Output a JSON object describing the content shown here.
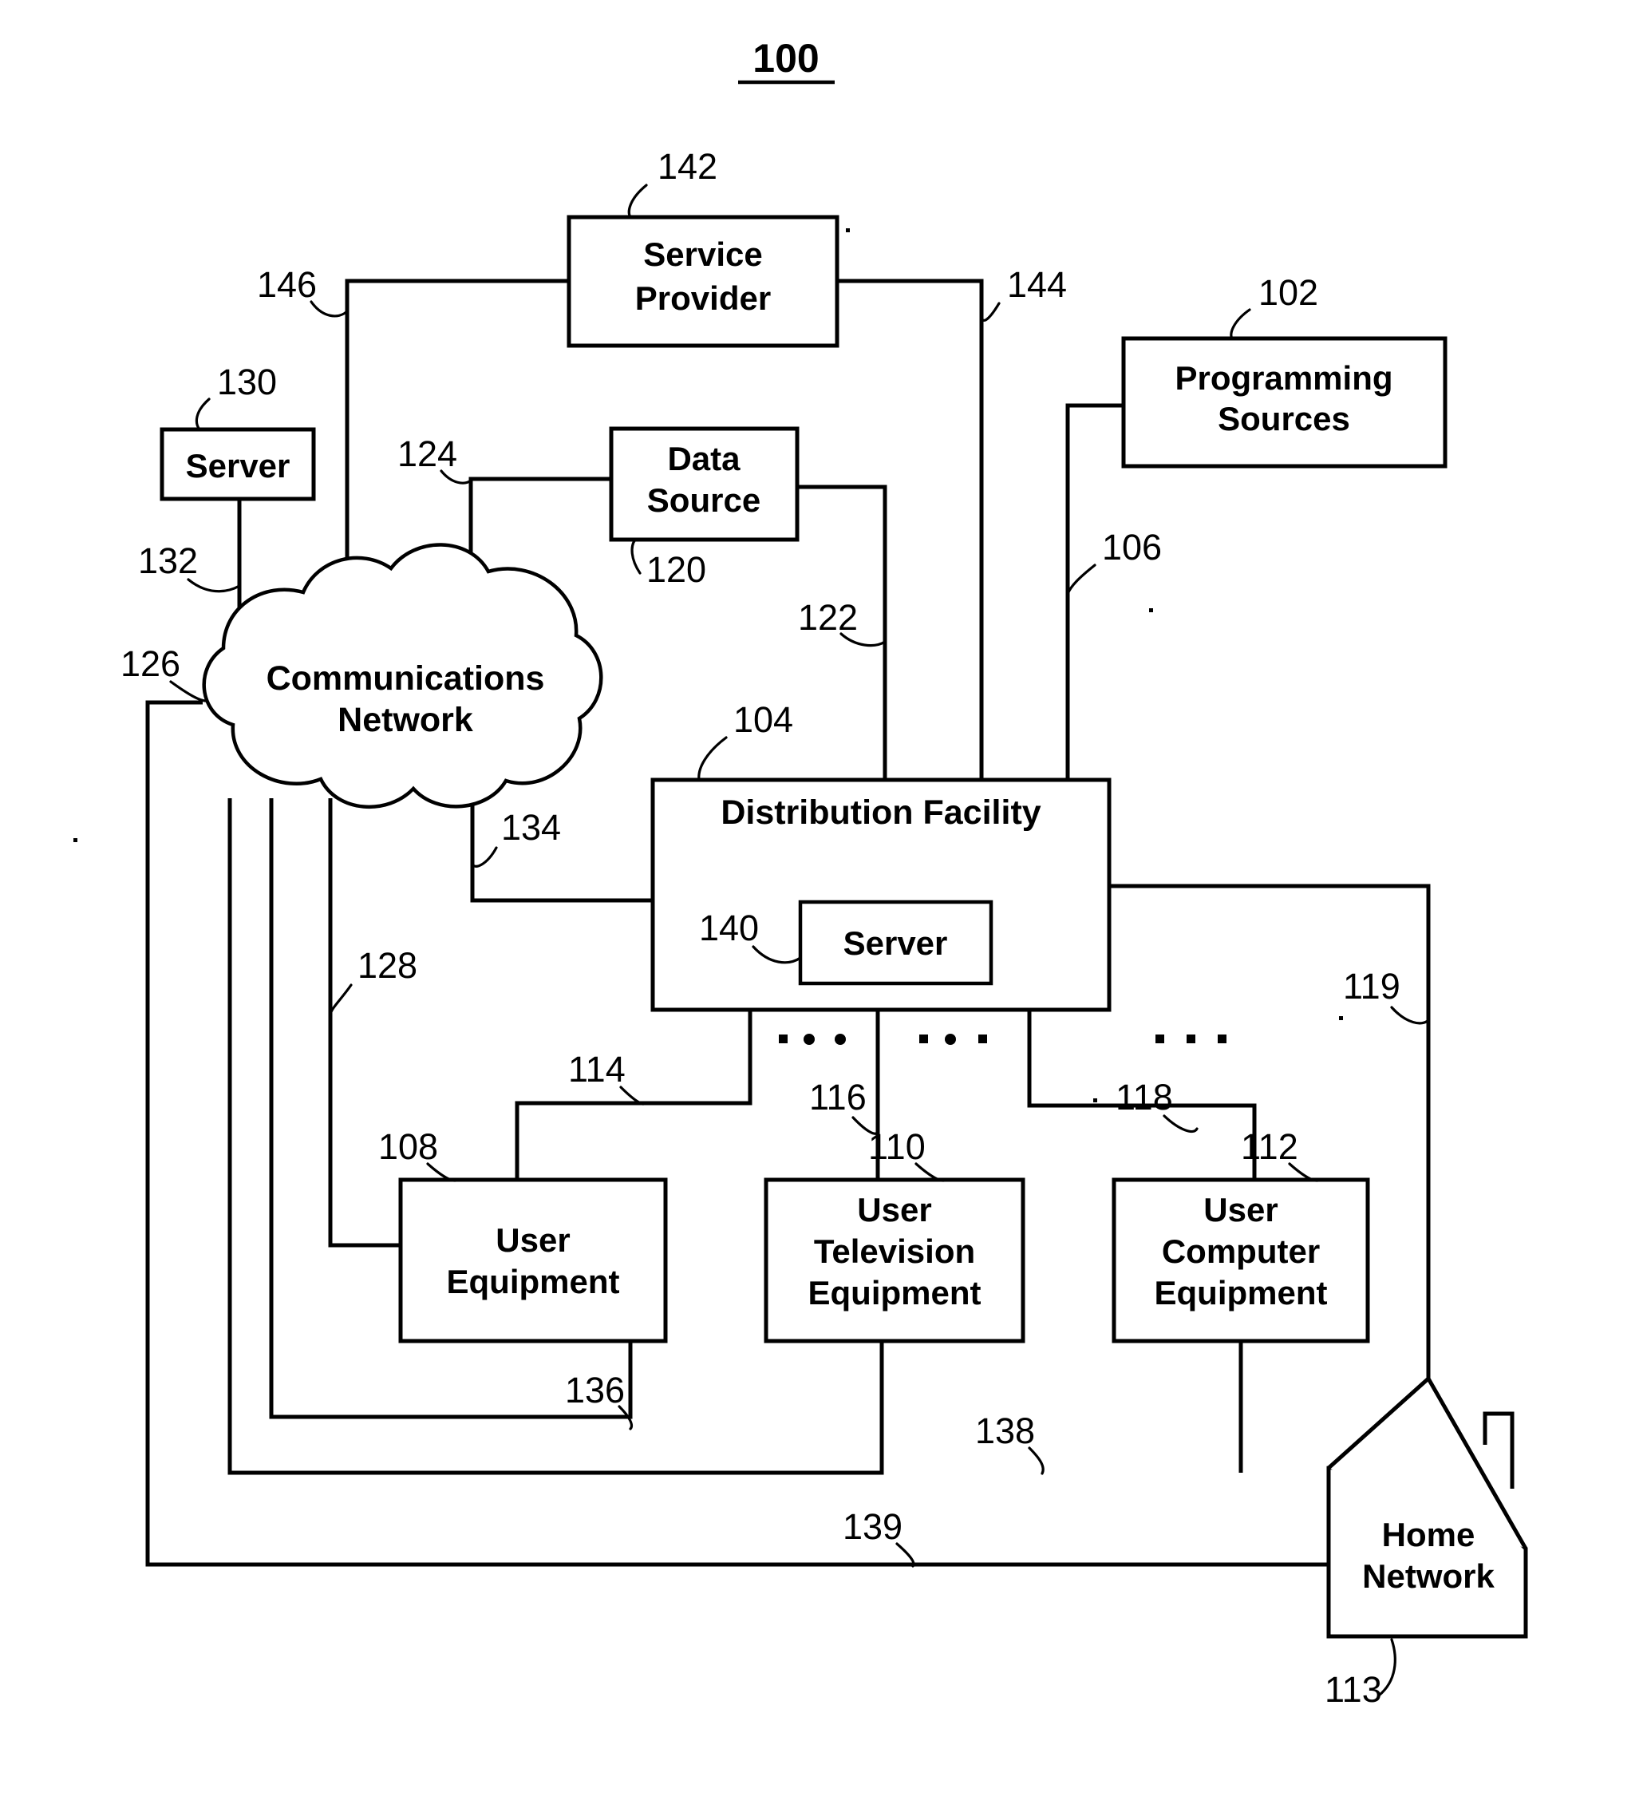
{
  "figure": {
    "title": "100",
    "title_underline": true
  },
  "nodes": {
    "service_provider": {
      "label_line1": "Service",
      "label_line2": "Provider",
      "ref": "142"
    },
    "programming_sources": {
      "label_line1": "Programming",
      "label_line2": "Sources",
      "ref": "102"
    },
    "server_left": {
      "label": "Server",
      "ref": "130"
    },
    "data_source": {
      "label_line1": "Data",
      "label_line2": "Source",
      "ref": "120"
    },
    "communications_network": {
      "label_line1": "Communications",
      "label_line2": "Network",
      "ref": "126"
    },
    "distribution_facility": {
      "label": "Distribution Facility",
      "ref": "104"
    },
    "server_df": {
      "label": "Server",
      "ref": "140"
    },
    "user_equipment": {
      "label_line1": "User",
      "label_line2": "Equipment",
      "ref": "108"
    },
    "user_television_equipment": {
      "label_line1": "User",
      "label_line2": "Television",
      "label_line3": "Equipment",
      "ref": "110"
    },
    "user_computer_equipment": {
      "label_line1": "User",
      "label_line2": "Computer",
      "label_line3": "Equipment",
      "ref": "112"
    },
    "home_network": {
      "label_line1": "Home",
      "label_line2": "Network",
      "ref": "113"
    }
  },
  "link_refs": {
    "sp_to_cloud": "146",
    "sp_to_df": "144",
    "ps_to_df": "106",
    "server_to_cloud": "132",
    "cloud_to_ue_left": "126",
    "data_source_to_cloud": "124",
    "data_source_to_df": "122",
    "cloud_to_df": "134",
    "cloud_to_ue": "128",
    "df_to_ue": "114",
    "df_to_ute": "116",
    "df_to_uce": "118",
    "df_to_home_network": "119",
    "ue_bus_136": "136",
    "ute_bus_138": "138",
    "home_bus_139": "139"
  },
  "colors": {
    "line": "#000000",
    "background": "#ffffff",
    "text": "#000000"
  }
}
